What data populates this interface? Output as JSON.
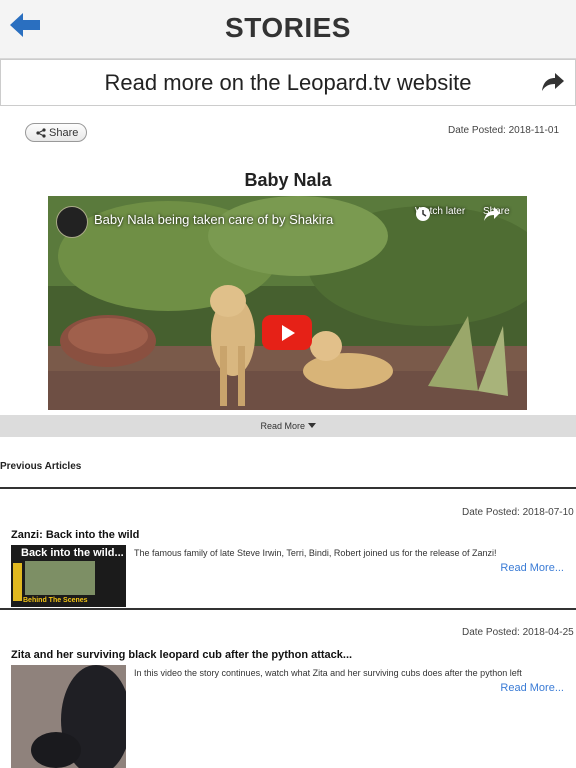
{
  "header": {
    "title": "STORIES",
    "back_icon": "arrow-left-icon",
    "accent": "#2a6fc0"
  },
  "website_bar": {
    "label": "Read more on the Leopard.tv website",
    "icon": "share-arrow-icon"
  },
  "article": {
    "share_label": "Share",
    "date_posted": "Date Posted: 2018-11-01",
    "title": "Baby Nala",
    "video": {
      "title": "Baby Nala being taken care of by Shakira",
      "watch_later": "Watch later",
      "share": "Share"
    },
    "read_more": "Read More"
  },
  "previous": {
    "heading": "Previous Articles",
    "items": [
      {
        "date_posted": "Date Posted: 2018-07-10",
        "title": "Zanzi: Back into the wild",
        "description": "The famous family of late Steve Irwin, Terri, Bindi, Robert joined us for the release of Zanzi!",
        "read_more": "Read More...",
        "thumb_text": "Back into the wild...",
        "thumb_footer": "Behind The Scenes"
      },
      {
        "date_posted": "Date Posted: 2018-04-25",
        "title": "Zita and her surviving black leopard cub after the python attack...",
        "description": "In this video the story continues, watch what Zita and her surviving cubs does after the python left",
        "read_more": "Read More..."
      }
    ]
  }
}
